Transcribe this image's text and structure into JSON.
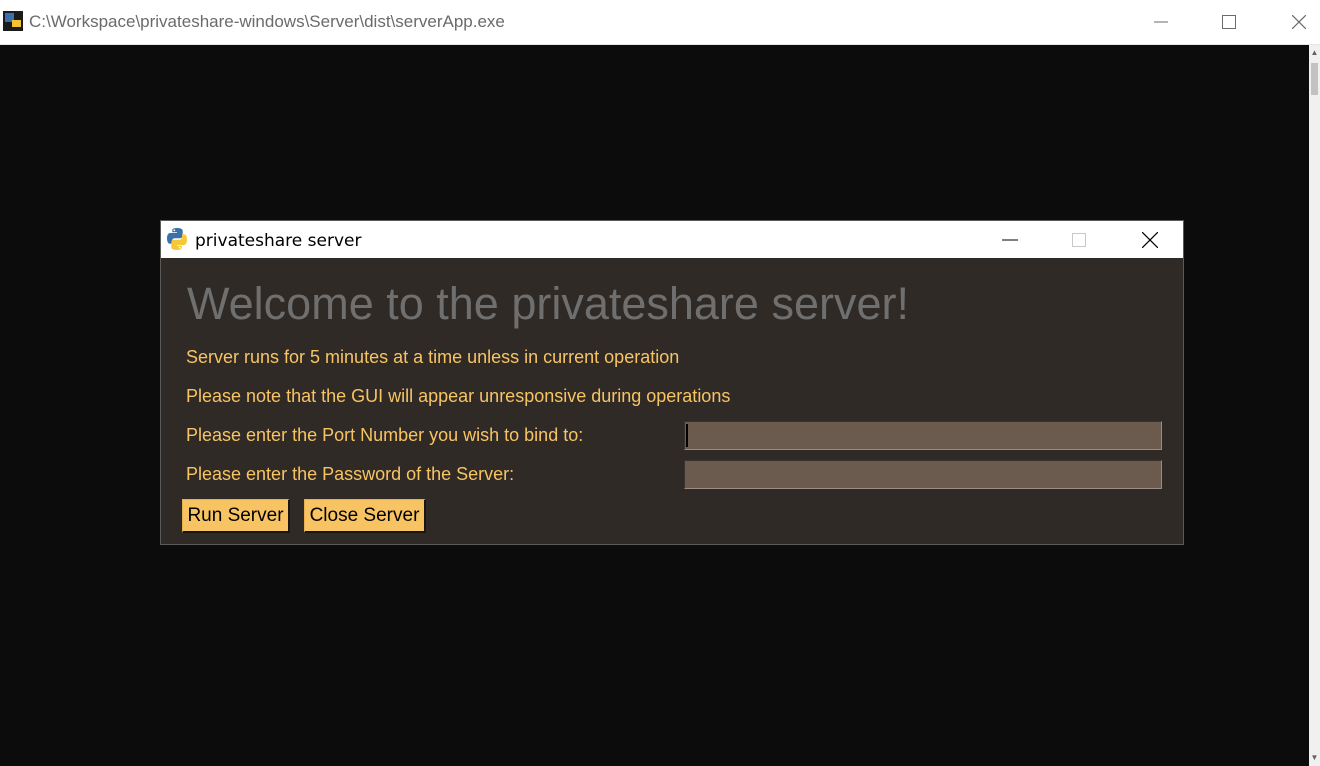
{
  "console": {
    "title": "C:\\Workspace\\privateshare-windows\\Server\\dist\\serverApp.exe",
    "icon": "console-app-icon",
    "background": "#0c0c0c"
  },
  "dialog": {
    "title": "privateshare server",
    "icon": "python-icon",
    "background": "#2f2a26",
    "accent_text": "#f8c463",
    "heading": "Welcome to the privateshare server!",
    "info_lines": [
      "Server runs for 5 minutes at a time unless in current operation",
      "Please note that the GUI will appear unresponsive during operations"
    ],
    "port_label": "Please enter the Port Number you wish to bind to:",
    "port_value": "",
    "password_label": "Please enter the Password of the Server:",
    "password_value": "",
    "run_button": "Run Server",
    "close_button": "Close Server"
  }
}
